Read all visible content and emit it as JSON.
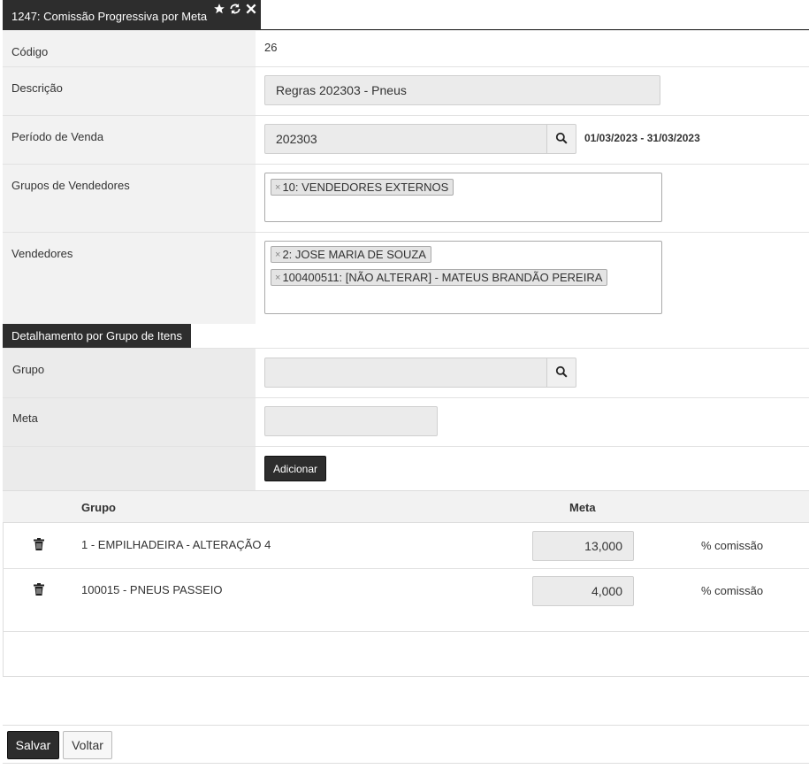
{
  "window": {
    "title": "1247: Comissão Progressiva por Meta",
    "icons": [
      "star-icon",
      "refresh-icon",
      "close-icon"
    ]
  },
  "form": {
    "codigo": {
      "label": "Código",
      "value": "26"
    },
    "descricao": {
      "label": "Descrição",
      "value": "Regras 202303 - Pneus"
    },
    "periodo": {
      "label": "Período de Venda",
      "value": "202303",
      "range": "01/03/2023 - 31/03/2023"
    },
    "grupos_vendedores": {
      "label": "Grupos de Vendedores",
      "tags": [
        "10: VENDEDORES EXTERNOS"
      ]
    },
    "vendedores": {
      "label": "Vendedores",
      "tags": [
        "2: JOSE MARIA DE SOUZA",
        "100400511: [NÃO ALTERAR] - MATEUS BRANDÃO PEREIRA"
      ]
    }
  },
  "detalhamento": {
    "section_title": "Detalhamento por Grupo de Itens",
    "grupo_label": "Grupo",
    "grupo_value": "",
    "meta_label": "Meta",
    "meta_value": "",
    "add_button": "Adicionar"
  },
  "table": {
    "headers": {
      "grupo": "Grupo",
      "meta": "Meta"
    },
    "rows": [
      {
        "grupo": "1 - EMPILHADEIRA - ALTERAÇÃO 4",
        "meta": "13,000",
        "unit": "% comissão"
      },
      {
        "grupo": "100015 - PNEUS PASSEIO",
        "meta": "4,000",
        "unit": "% comissão"
      }
    ]
  },
  "footer": {
    "save": "Salvar",
    "back": "Voltar"
  }
}
